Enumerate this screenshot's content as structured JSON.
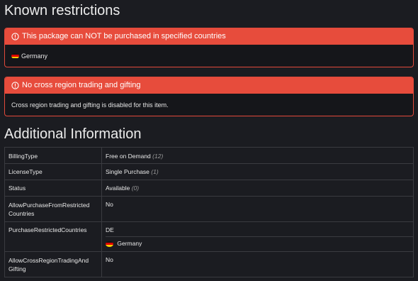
{
  "known_restrictions": {
    "title": "Known restrictions",
    "alerts": [
      {
        "icon": "alert-circle-icon",
        "header": "This package can NOT be purchased in specified countries",
        "body": "Germany",
        "flag": "germany-flag-icon"
      },
      {
        "icon": "alert-circle-icon",
        "header": "No cross region trading and gifting",
        "body": "Cross region trading and gifting is disabled for this item."
      }
    ]
  },
  "additional_info": {
    "title": "Additional Information",
    "rows": [
      {
        "key": "BillingType",
        "value": "Free on Demand",
        "note": "(12)"
      },
      {
        "key": "LicenseType",
        "value": "Single Purchase",
        "note": "(1)"
      },
      {
        "key": "Status",
        "value": "Available",
        "note": "(0)"
      },
      {
        "key": "AllowPurchaseFromRestricted Countries",
        "value": "No",
        "note": ""
      },
      {
        "key": "PurchaseRestrictedCountries",
        "value": "DE",
        "subvalue": "Germany"
      },
      {
        "key": "AllowCrossRegionTradingAnd Gifting",
        "value": "No",
        "note": ""
      }
    ]
  },
  "colors": {
    "accent": "#e74c3c",
    "background": "#1b1c21",
    "border": "#3a3b40"
  }
}
